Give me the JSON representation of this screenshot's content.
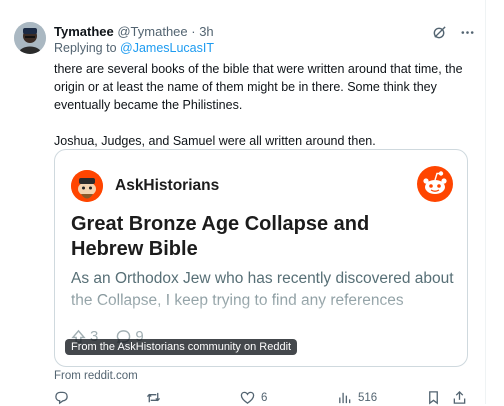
{
  "tweet": {
    "author_name": "Tymathee",
    "author_handle": "@Tymathee",
    "separator": " · ",
    "time": "3h",
    "reply_prefix": "Replying to ",
    "reply_mention": "@JamesLucasIT",
    "paragraphs": [
      "there are several books of the bible that were written around that time, the origin or at least the name of them might be in there. Some think they eventually became the Philistines.",
      "Joshua, Judges, and Samuel were all written around then."
    ]
  },
  "card": {
    "subreddit": "AskHistorians",
    "title": "Great Bronze Age Collapse and Hebrew Bible",
    "body": "As an Orthodox Jew who has recently discovered about the Collapse, I keep trying to find any references",
    "upvotes": "3",
    "comments": "9",
    "caption": "From the AskHistorians community on Reddit",
    "brand_color": "#ff4500"
  },
  "from_line": "From reddit.com",
  "actions": {
    "reply_count": "",
    "retweet_count": "",
    "like_count": "6",
    "views_count": "516"
  },
  "icons": [
    "grok-icon",
    "more-icon",
    "reply-icon",
    "retweet-icon",
    "like-icon",
    "views-icon",
    "bookmark-icon",
    "share-icon"
  ]
}
